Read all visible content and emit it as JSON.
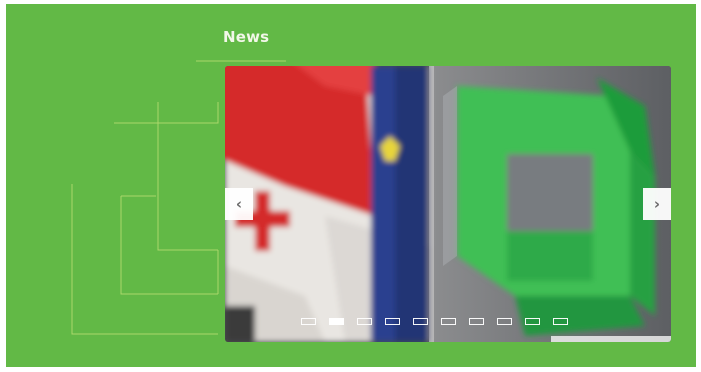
{
  "news": {
    "title": "News"
  },
  "slider": {
    "prev_label": "‹",
    "next_label": "›",
    "dots": [
      {
        "active": false
      },
      {
        "active": true
      },
      {
        "active": false
      },
      {
        "active": false
      },
      {
        "active": false
      },
      {
        "active": false
      },
      {
        "active": false
      },
      {
        "active": false
      },
      {
        "active": false
      },
      {
        "active": false
      }
    ]
  },
  "colors": {
    "panel_bg": "#62b946",
    "accent": "#2aa83e"
  },
  "icons": {
    "prev": "chevron-left-icon",
    "next": "chevron-right-icon"
  }
}
